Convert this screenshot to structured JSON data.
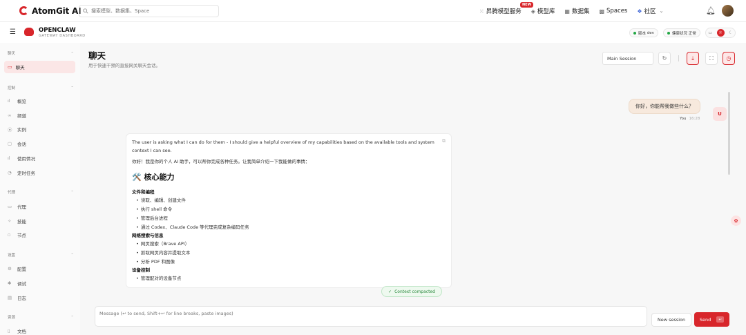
{
  "topbar": {
    "brand": "AtomGit AI",
    "search_placeholder": "搜索模型、数据集、Space",
    "nav": [
      {
        "icon": "grid-icon",
        "label": "昇腾模型服务",
        "badge": "NEW"
      },
      {
        "icon": "cube-icon",
        "label": "模型库"
      },
      {
        "icon": "database-icon",
        "label": "数据集"
      },
      {
        "icon": "square-icon",
        "label": "Spaces"
      },
      {
        "icon": "users-icon",
        "label": "社区"
      }
    ]
  },
  "subheader": {
    "title": "OPENCLAW",
    "subtitle": "GATEWAY DASHBOARD",
    "version_label": "版本",
    "version_value": "dev",
    "health_label": "健康状况",
    "health_value": "正常"
  },
  "sidebar": {
    "sections": [
      {
        "title": "聊天",
        "items": [
          {
            "icon": "chat-icon",
            "label": "聊天",
            "active": true
          }
        ]
      },
      {
        "title": "控制",
        "items": [
          {
            "icon": "bar-chart-icon",
            "label": "概览"
          },
          {
            "icon": "link-icon",
            "label": "频道"
          },
          {
            "icon": "broadcast-icon",
            "label": "实例"
          },
          {
            "icon": "document-icon",
            "label": "会话"
          },
          {
            "icon": "bar-chart-icon",
            "label": "使用情况"
          },
          {
            "icon": "clock-icon",
            "label": "定时任务"
          }
        ]
      },
      {
        "title": "代理",
        "items": [
          {
            "icon": "folder-icon",
            "label": "代理"
          },
          {
            "icon": "sparkle-icon",
            "label": "技能"
          },
          {
            "icon": "node-icon",
            "label": "节点"
          }
        ]
      },
      {
        "title": "设置",
        "items": [
          {
            "icon": "gear-icon",
            "label": "配置"
          },
          {
            "icon": "bug-icon",
            "label": "调试"
          },
          {
            "icon": "log-icon",
            "label": "日志"
          }
        ]
      },
      {
        "title": "资源",
        "items": [
          {
            "icon": "book-icon",
            "label": "文档"
          }
        ]
      }
    ]
  },
  "main": {
    "title": "聊天",
    "subtitle": "用于快速干预的直接网关聊天会话。",
    "session_select": "Main Session"
  },
  "chat": {
    "user_message": "你好，你能帮我做些什么？",
    "user_avatar": "U",
    "user_name": "You",
    "user_time": "16:28",
    "assistant": {
      "thinking": "The user is asking what I can do for them - I should give a helpful overview of my capabilities based on the available tools and system context I can see.",
      "intro": "你好！我是你的个人 AI 助手，可以帮你完成各种任务。让我简单介绍一下我能做的事情：",
      "heading": "🛠️ 核心能力",
      "groups": [
        {
          "title": "文件和编程",
          "items": [
            "读取、编辑、创建文件",
            "执行 shell 命令",
            "管理后台进程",
            "通过 Codex、Claude Code 等代理完成复杂编码任务"
          ]
        },
        {
          "title": "网络搜索与信息",
          "items": [
            "网页搜索（Brave API）",
            "抓取网页内容并提取文本",
            "分析 PDF 和图像"
          ]
        },
        {
          "title": "设备控制",
          "items": [
            "管理配对的设备节点"
          ]
        }
      ]
    },
    "context_status": "Context compacted"
  },
  "composer": {
    "placeholder": "Message (↩ to send, Shift+↩ for line breaks, paste images)",
    "new_session": "New session",
    "send": "Send"
  },
  "colors": {
    "accent": "#d8262b",
    "success": "#22a744"
  }
}
